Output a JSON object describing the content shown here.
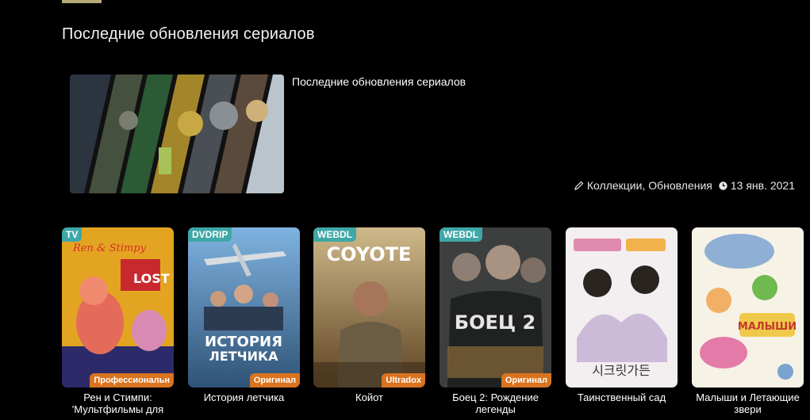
{
  "section": {
    "title": "Последние обновления сериалов"
  },
  "collection": {
    "title": "Последние обновления сериалов",
    "categories": "Коллекции, Обновления",
    "date": "13 янв. 2021"
  },
  "shows": [
    {
      "title": "Рен и Стимпи: 'Мультфильмы для",
      "quality": "TV",
      "translation": "Профессиональн",
      "poster_color": "#e3a521"
    },
    {
      "title": "История летчика",
      "quality": "DVDRIP",
      "translation": "Оригинал",
      "poster_color": "#3e6b9b"
    },
    {
      "title": "Койот",
      "quality": "WEBDL",
      "translation": "Ultradox",
      "poster_color": "#7a5a30"
    },
    {
      "title": "Боец 2: Рождение легенды",
      "quality": "WEBDL",
      "translation": "Оригинал",
      "poster_color": "#3c3f3e"
    },
    {
      "title": "Таинственный сад",
      "quality": "",
      "translation": "",
      "poster_color": "#f3eef0"
    },
    {
      "title": "Малыши и Летающие звери",
      "quality": "",
      "translation": "",
      "poster_color": "#f7f2e6"
    }
  ],
  "colors": {
    "accent": "#b8a97a",
    "quality_badge": "#3fa7a7",
    "translation_badge": "#d9731f"
  }
}
